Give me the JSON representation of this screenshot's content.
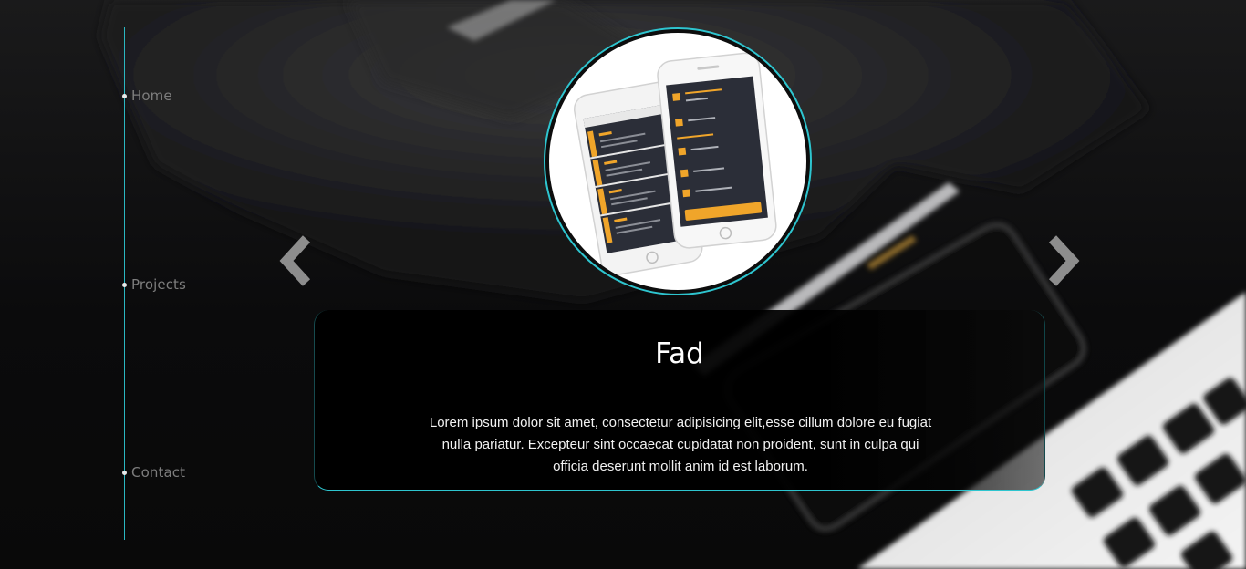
{
  "nav": {
    "items": [
      {
        "label": "Home"
      },
      {
        "label": "Projects"
      },
      {
        "label": "Contact"
      }
    ],
    "line_color": "#2ab7c1"
  },
  "carousel": {
    "prev_icon": "chevron-left-icon",
    "next_icon": "chevron-right-icon"
  },
  "project": {
    "title": "Fad",
    "description": "Lorem ipsum dolor sit amet, consectetur adipisicing elit,esse cillum dolore eu fugiat nulla pariatur. Excepteur sint occaecat cupidatat non proident, sunt in culpa qui officia deserunt mollit anim id est laborum.",
    "image_alt": "app-mockup-phones"
  },
  "colors": {
    "accent": "#2ec5cf",
    "app_orange": "#f0a52a",
    "app_dark": "#2b2e38"
  }
}
